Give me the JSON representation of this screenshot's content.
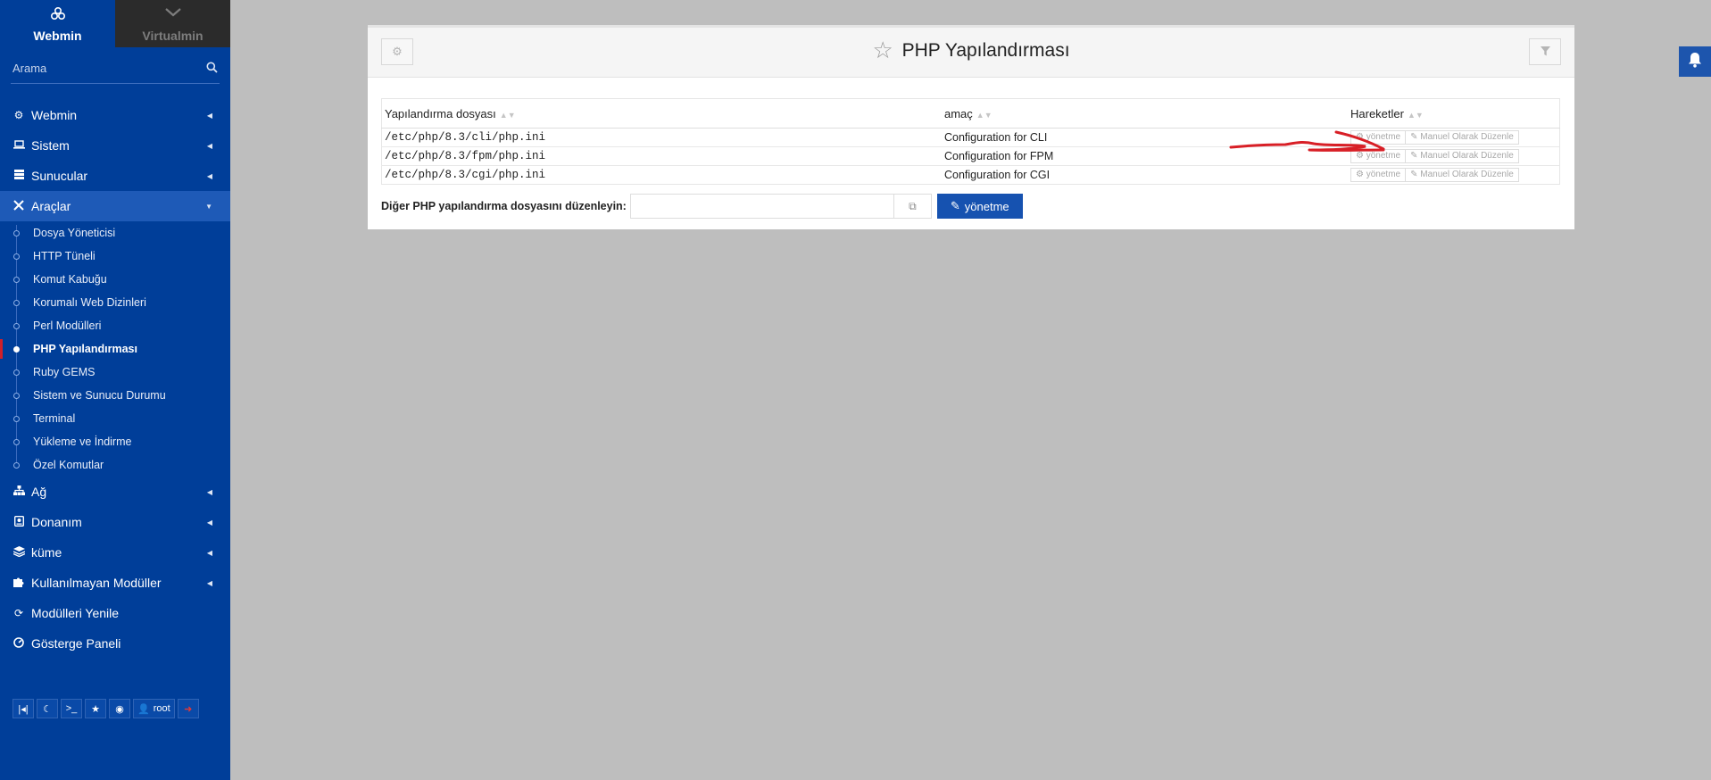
{
  "sidebar": {
    "tabs": [
      {
        "label": "Webmin",
        "icon": "webmin-logo-icon"
      },
      {
        "label": "Virtualmin",
        "icon": "virtualmin-logo-icon"
      }
    ],
    "search_placeholder": "Arama",
    "menu_top": [
      {
        "label": "Webmin",
        "icon": "gear-icon"
      },
      {
        "label": "Sistem",
        "icon": "laptop-icon"
      },
      {
        "label": "Sunucular",
        "icon": "server-icon"
      },
      {
        "label": "Araçlar",
        "icon": "tools-icon"
      }
    ],
    "tools_submenu": [
      "Dosya Yöneticisi",
      "HTTP Tüneli",
      "Komut Kabuğu",
      "Korumalı Web Dizinleri",
      "Perl Modülleri",
      "PHP Yapılandırması",
      "Ruby GEMS",
      "Sistem ve Sunucu Durumu",
      "Terminal",
      "Yükleme ve İndirme",
      "Özel Komutlar"
    ],
    "active_submenu": "PHP Yapılandırması",
    "menu_bottom": [
      {
        "label": "Ağ",
        "icon": "network-icon"
      },
      {
        "label": "Donanım",
        "icon": "hdd-icon"
      },
      {
        "label": "küme",
        "icon": "layers-icon"
      },
      {
        "label": "Kullanılmayan Modüller",
        "icon": "puzzle-icon"
      },
      {
        "label": "Modülleri Yenile",
        "icon": "refresh-icon"
      },
      {
        "label": "Gösterge Paneli",
        "icon": "dashboard-icon"
      }
    ],
    "footer_user": "root"
  },
  "panel": {
    "title": "PHP Yapılandırması",
    "table": {
      "headers": [
        "Yapılandırma dosyası",
        "amaç",
        "Hareketler"
      ],
      "rows": [
        {
          "path": "/etc/php/8.3/cli/php.ini",
          "purpose": "Configuration for CLI"
        },
        {
          "path": "/etc/php/8.3/fpm/php.ini",
          "purpose": "Configuration for FPM"
        },
        {
          "path": "/etc/php/8.3/cgi/php.ini",
          "purpose": "Configuration for CGI"
        }
      ],
      "action_manage": "yönetme",
      "action_edit": "Manuel Olarak Düzenle"
    },
    "other_label": "Diğer PHP yapılandırma dosyasını düzenleyin:",
    "other_value": "",
    "manage_button": "yönetme"
  },
  "colors": {
    "sidebar_bg": "#003e99",
    "accent": "#1652b0",
    "annotation": "#d81f26"
  }
}
